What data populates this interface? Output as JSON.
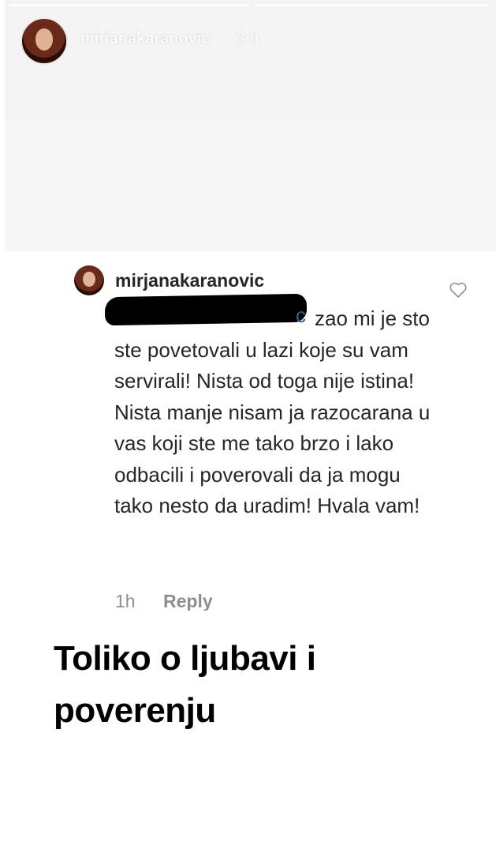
{
  "story": {
    "username": "mirjanakaranovic",
    "time": "3 h"
  },
  "comment": {
    "username": "mirjanakaranovic",
    "mention_tail": "c",
    "text": "zao mi je sto ste povetovali u lazi koje su vam servirali! Nista od toga nije istina! Nista manje nisam ja razocarana u vas koji ste me tako brzo i lako odbacili i poverovali da ja mogu tako nesto da uradim! Hvala vam!",
    "time": "1h",
    "reply_label": "Reply"
  },
  "caption": "Toliko o ljubavi i poverenju",
  "icons": {
    "like": "heart-icon",
    "avatar": "profile-avatar"
  },
  "colors": {
    "text": "#262626",
    "meta": "#8e8e8e",
    "mention": "#2f5f94",
    "redaction": "#000000"
  }
}
